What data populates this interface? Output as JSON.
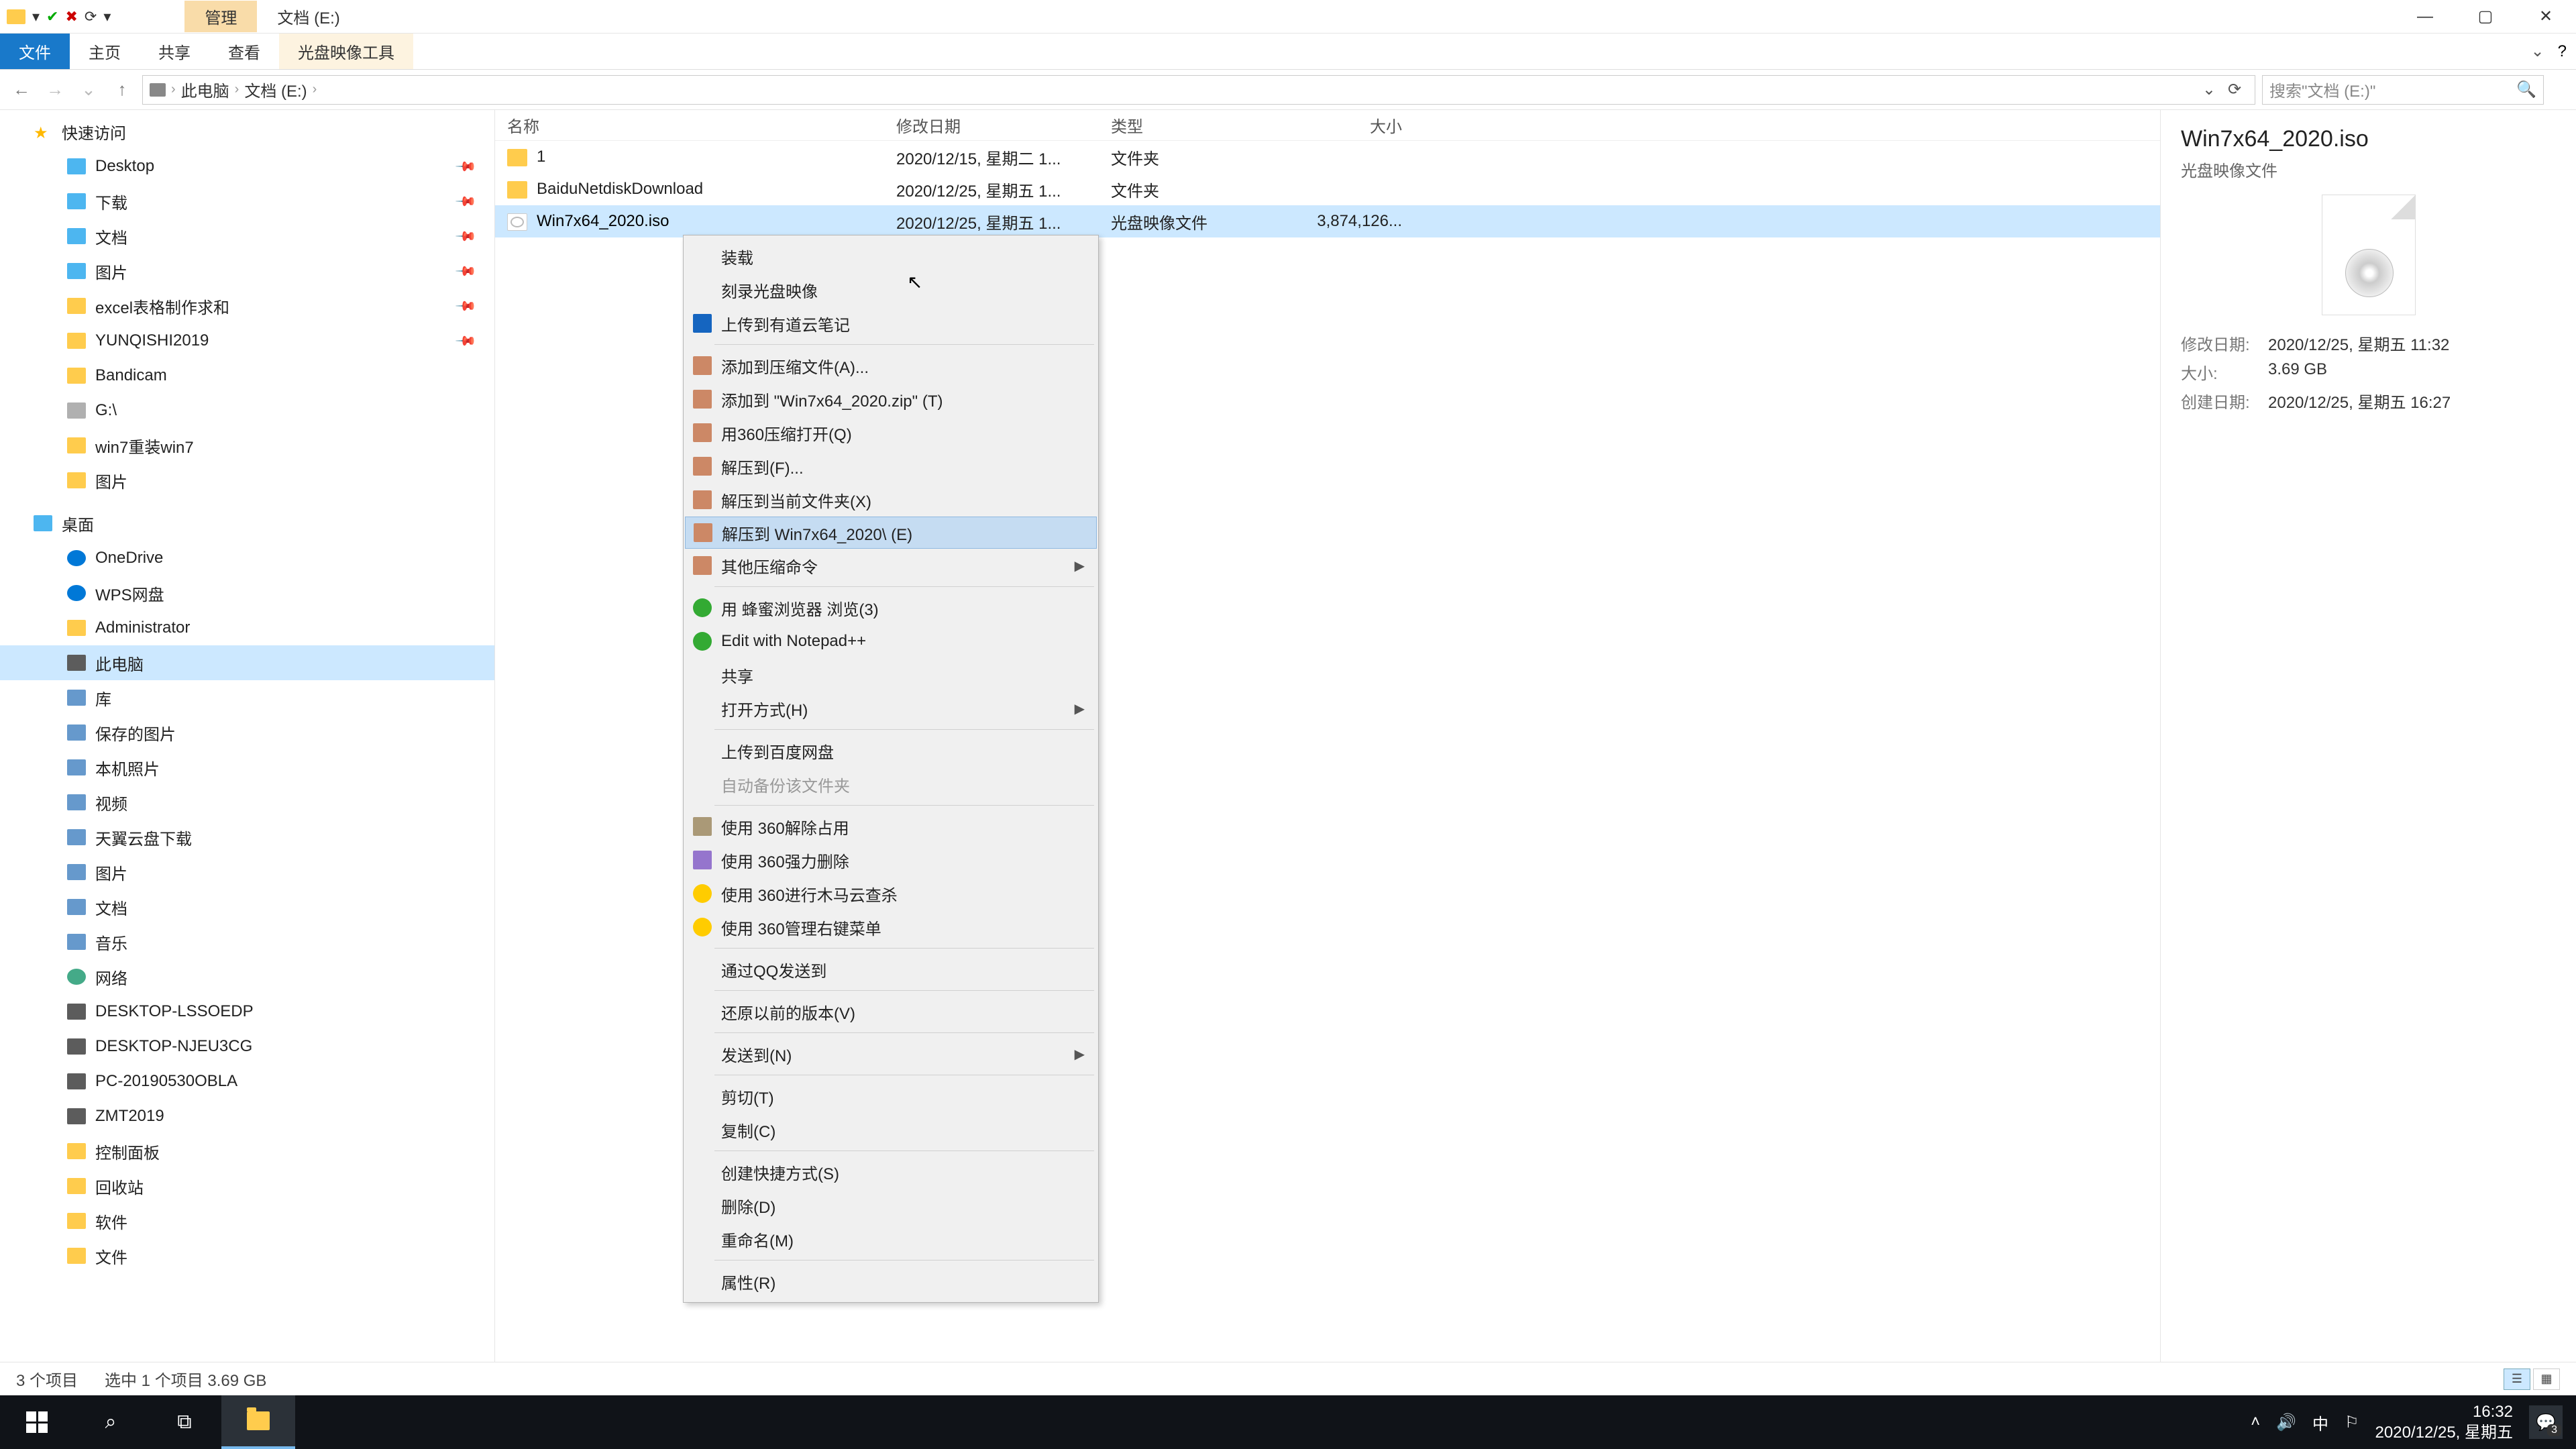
{
  "titlebar": {
    "qat_icons": [
      "▾",
      "✔",
      "✖",
      "⟳",
      "▾"
    ],
    "contextual_tab": "管理",
    "window_title": "文档 (E:)"
  },
  "ribbon": {
    "file": "文件",
    "tabs": [
      "主页",
      "共享",
      "查看",
      "光盘映像工具"
    ]
  },
  "address": {
    "back": "←",
    "forward": "→",
    "up": "↑",
    "crumbs": [
      "此电脑",
      "文档 (E:)"
    ],
    "search_placeholder": "搜索\"文档 (E:)\""
  },
  "nav": {
    "quick_access": "快速访问",
    "quick_items": [
      {
        "label": "Desktop",
        "ico": "blue",
        "pin": true
      },
      {
        "label": "下载",
        "ico": "blue",
        "pin": true
      },
      {
        "label": "文档",
        "ico": "blue",
        "pin": true
      },
      {
        "label": "图片",
        "ico": "blue",
        "pin": true
      },
      {
        "label": "excel表格制作求和",
        "ico": "folder",
        "pin": true
      },
      {
        "label": "YUNQISHI2019",
        "ico": "folder",
        "pin": true
      },
      {
        "label": "Bandicam",
        "ico": "folder",
        "pin": false
      },
      {
        "label": "G:\\",
        "ico": "drive",
        "pin": false
      },
      {
        "label": "win7重装win7",
        "ico": "folder",
        "pin": false
      },
      {
        "label": "图片",
        "ico": "folder",
        "pin": false
      }
    ],
    "desktop": "桌面",
    "desktop_items": [
      {
        "label": "OneDrive",
        "ico": "cloud"
      },
      {
        "label": "WPS网盘",
        "ico": "cloud"
      },
      {
        "label": "Administrator",
        "ico": "folder"
      },
      {
        "label": "此电脑",
        "ico": "pc",
        "selected": true
      },
      {
        "label": "库",
        "ico": "lib"
      }
    ],
    "lib_items": [
      "保存的图片",
      "本机照片",
      "视频",
      "天翼云盘下载",
      "图片",
      "文档",
      "音乐"
    ],
    "network": "网络",
    "net_items": [
      "DESKTOP-LSSOEDP",
      "DESKTOP-NJEU3CG",
      "PC-20190530OBLA",
      "ZMT2019"
    ],
    "bottom_items": [
      "控制面板",
      "回收站",
      "软件",
      "文件"
    ]
  },
  "list": {
    "headers": {
      "name": "名称",
      "date": "修改日期",
      "type": "类型",
      "size": "大小"
    },
    "rows": [
      {
        "name": "1",
        "date": "2020/12/15, 星期二 1...",
        "type": "文件夹",
        "size": "",
        "ico": "folder"
      },
      {
        "name": "BaiduNetdiskDownload",
        "date": "2020/12/25, 星期五 1...",
        "type": "文件夹",
        "size": "",
        "ico": "folder"
      },
      {
        "name": "Win7x64_2020.iso",
        "date": "2020/12/25, 星期五 1...",
        "type": "光盘映像文件",
        "size": "3,874,126...",
        "ico": "iso",
        "selected": true
      }
    ]
  },
  "context_menu": {
    "items": [
      {
        "label": "装载",
        "icon": "disc"
      },
      {
        "label": "刻录光盘映像",
        "icon": ""
      },
      {
        "label": "上传到有道云笔记",
        "icon": "note"
      },
      {
        "sep": true
      },
      {
        "label": "添加到压缩文件(A)...",
        "icon": "zip"
      },
      {
        "label": "添加到 \"Win7x64_2020.zip\" (T)",
        "icon": "zip"
      },
      {
        "label": "用360压缩打开(Q)",
        "icon": "zip"
      },
      {
        "label": "解压到(F)...",
        "icon": "zip"
      },
      {
        "label": "解压到当前文件夹(X)",
        "icon": "zip"
      },
      {
        "label": "解压到 Win7x64_2020\\ (E)",
        "icon": "zip",
        "hover": true
      },
      {
        "label": "其他压缩命令",
        "icon": "zip",
        "arrow": true
      },
      {
        "sep": true
      },
      {
        "label": "用 蜂蜜浏览器 浏览(3)",
        "icon": "green"
      },
      {
        "label": "Edit with Notepad++",
        "icon": "green"
      },
      {
        "label": "共享",
        "icon": "share"
      },
      {
        "label": "打开方式(H)",
        "icon": "",
        "arrow": true
      },
      {
        "sep": true
      },
      {
        "label": "上传到百度网盘",
        "icon": "cloud"
      },
      {
        "label": "自动备份该文件夹",
        "icon": "",
        "disabled": true
      },
      {
        "sep": true
      },
      {
        "label": "使用 360解除占用",
        "icon": "box"
      },
      {
        "label": "使用 360强力删除",
        "icon": "purple"
      },
      {
        "label": "使用 360进行木马云查杀",
        "icon": "yellow"
      },
      {
        "label": "使用 360管理右键菜单",
        "icon": "yellow"
      },
      {
        "sep": true
      },
      {
        "label": "通过QQ发送到",
        "icon": ""
      },
      {
        "sep": true
      },
      {
        "label": "还原以前的版本(V)",
        "icon": ""
      },
      {
        "sep": true
      },
      {
        "label": "发送到(N)",
        "icon": "",
        "arrow": true
      },
      {
        "sep": true
      },
      {
        "label": "剪切(T)",
        "icon": ""
      },
      {
        "label": "复制(C)",
        "icon": ""
      },
      {
        "sep": true
      },
      {
        "label": "创建快捷方式(S)",
        "icon": ""
      },
      {
        "label": "删除(D)",
        "icon": ""
      },
      {
        "label": "重命名(M)",
        "icon": ""
      },
      {
        "sep": true
      },
      {
        "label": "属性(R)",
        "icon": ""
      }
    ]
  },
  "details": {
    "title": "Win7x64_2020.iso",
    "subtitle": "光盘映像文件",
    "props": [
      {
        "label": "修改日期:",
        "value": "2020/12/25, 星期五 11:32"
      },
      {
        "label": "大小:",
        "value": "3.69 GB"
      },
      {
        "label": "创建日期:",
        "value": "2020/12/25, 星期五 16:27"
      }
    ]
  },
  "statusbar": {
    "count": "3 个项目",
    "selection": "选中 1 个项目  3.69 GB"
  },
  "taskbar": {
    "time": "16:32",
    "date": "2020/12/25, 星期五",
    "notif_count": "3",
    "ime": "中"
  }
}
